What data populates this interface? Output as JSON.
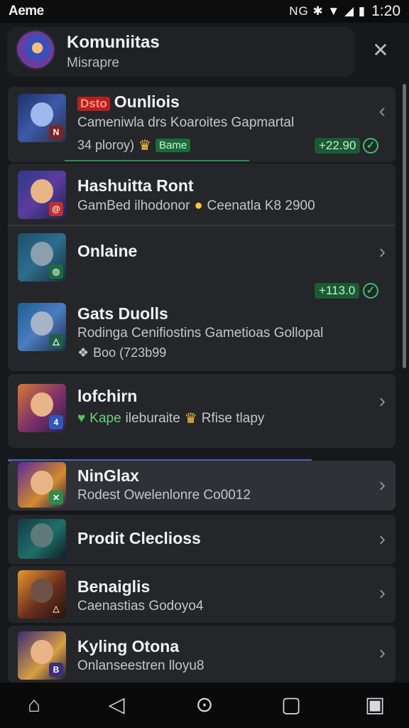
{
  "status_bar": {
    "app": "Aeme",
    "icons": "NG ✱ ▼ ◢ ▮",
    "time": "1:20"
  },
  "header": {
    "title": "Komuniitas",
    "subtitle": "Misrapre",
    "close_icon": "close-icon"
  },
  "card1": {
    "item1": {
      "tag": "Dsto",
      "title": "Ounliois",
      "subtitle": "Cameniwla drs Koaroites Gapmartal",
      "meta": "34 ploroy)",
      "pill": "Bame",
      "price": "+22.90"
    }
  },
  "card2": {
    "item1": {
      "title": "Hashuitta Ront",
      "subtitle_a": "GamBed ilhodonor",
      "subtitle_b": "Ceenatla K8 2900"
    },
    "item2": {
      "title": "Onlaine",
      "price": "+113.0"
    },
    "item3": {
      "title": "Gats Duolls",
      "subtitle": "Rodinga Cenifiostins Gametioas Gollopal",
      "meta": "Boo (723b99"
    }
  },
  "card3": {
    "item1": {
      "title": "lofchirn",
      "meta_a": "Kape",
      "meta_b": "ileburaite",
      "meta_c": "Rfise tlapy"
    }
  },
  "list": [
    {
      "title": "NinGlax",
      "subtitle": "Rodest Owelenlonre Co0012",
      "highlight": true
    },
    {
      "title": "Prodit Cleclioss",
      "subtitle": ""
    },
    {
      "title": "Benaiglis",
      "subtitle": "Caenastias Godoyo4"
    },
    {
      "title": "Kyling Otona",
      "subtitle": "Onlanseestren lloyu8"
    }
  ],
  "nav": {
    "home": "⌂",
    "back": "◁",
    "circle": "⊙",
    "square": "▢",
    "menu": "▣"
  }
}
